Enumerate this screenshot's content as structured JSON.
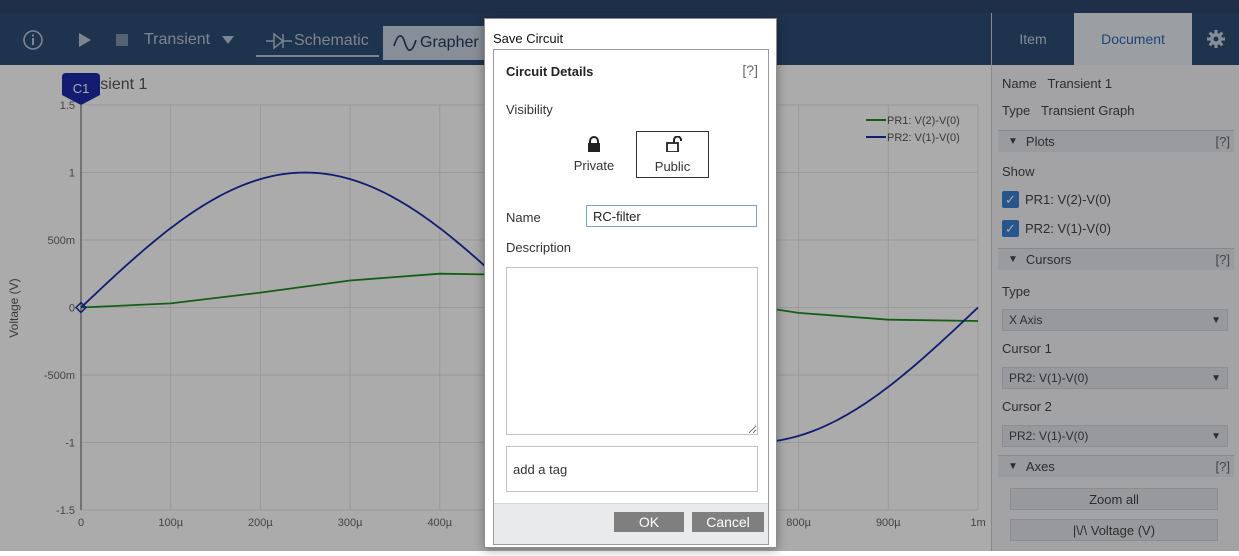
{
  "toolbar": {
    "info_icon": "info-circle-icon",
    "play_icon": "play-icon",
    "stop_icon": "stop-icon",
    "mode_label": "Transient",
    "tabs": [
      {
        "label": "Schematic",
        "icon": "diode-icon"
      },
      {
        "label": "Grapher",
        "icon": "sine-wave-icon"
      }
    ]
  },
  "graph": {
    "title": "Transient 1",
    "cursor_label": "C1",
    "y_axis_title": "Voltage (V)",
    "y_ticks": [
      "1.5",
      "1",
      "500m",
      "0",
      "-500m",
      "-1",
      "-1.5"
    ],
    "x_ticks": [
      "0",
      "100µ",
      "200µ",
      "300µ",
      "400µ",
      "800µ",
      "900µ",
      "1m"
    ],
    "legend": [
      {
        "name": "PR1: V(2)-V(0)",
        "color": "#1f8c1f"
      },
      {
        "name": "PR2: V(1)-V(0)",
        "color": "#1c2aa8"
      }
    ]
  },
  "chart_data": {
    "type": "line",
    "title": "Transient 1",
    "xlabel": "",
    "ylabel": "Voltage (V)",
    "xlim": [
      0,
      0.001
    ],
    "ylim": [
      -1.5,
      1.5
    ],
    "grid": true,
    "legend_position": "top-right",
    "series": [
      {
        "name": "PR1: V(2)-V(0)",
        "color": "#1f8c1f",
        "x": [
          0,
          0.0001,
          0.0002,
          0.0003,
          0.0004,
          0.0005,
          0.0006,
          0.0007,
          0.0008,
          0.0009,
          0.001
        ],
        "y": [
          0,
          0.03,
          0.11,
          0.2,
          0.25,
          0.24,
          0.17,
          0.06,
          -0.04,
          -0.09,
          -0.1
        ]
      },
      {
        "name": "PR2: V(1)-V(0)",
        "color": "#1c2aa8",
        "x": [
          0,
          5e-05,
          0.0001,
          0.00015,
          0.0002,
          0.00025,
          0.0003,
          0.00035,
          0.0004,
          0.00045,
          0.0005,
          0.00055,
          0.0006,
          0.00065,
          0.0007,
          0.00075,
          0.0008,
          0.00085,
          0.0009,
          0.00095,
          0.001
        ],
        "y": [
          0,
          0.31,
          0.59,
          0.81,
          0.95,
          1.0,
          0.95,
          0.81,
          0.59,
          0.31,
          0,
          -0.31,
          -0.59,
          -0.81,
          -0.95,
          -1.0,
          -0.95,
          -0.81,
          -0.59,
          -0.31,
          0
        ]
      }
    ]
  },
  "sidebar": {
    "tabs": [
      "Item",
      "Document"
    ],
    "settings_icon": "gear-icon",
    "name_label": "Name",
    "name_value": "Transient 1",
    "type_label": "Type",
    "type_value": "Transient Graph",
    "plots_section": "Plots",
    "help": "[?]",
    "show_label": "Show",
    "plots": [
      "PR1: V(2)-V(0)",
      "PR2: V(1)-V(0)"
    ],
    "cursors_section": "Cursors",
    "cursor_type_label": "Type",
    "cursor_type_value": "X Axis",
    "cursor1_label": "Cursor 1",
    "cursor1_value": "PR2: V(1)-V(0)",
    "cursor2_label": "Cursor 2",
    "cursor2_value": "PR2: V(1)-V(0)",
    "axes_section": "Axes",
    "zoom_all": "Zoom all",
    "voltage_button": "|\\/\\  Voltage (V)"
  },
  "dialog": {
    "title": "Save Circuit",
    "section_title": "Circuit Details",
    "help": "[?]",
    "visibility_label": "Visibility",
    "private_label": "Private",
    "public_label": "Public",
    "name_label": "Name",
    "name_value": "RC-filter",
    "description_label": "Description",
    "description_value": "",
    "tag_placeholder": "add a tag",
    "ok_label": "OK",
    "cancel_label": "Cancel"
  }
}
